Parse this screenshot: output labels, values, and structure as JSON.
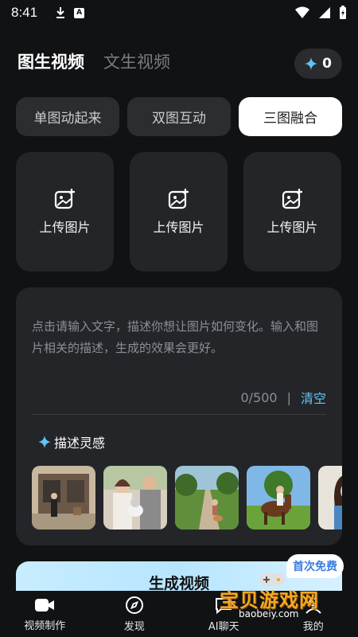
{
  "status_bar": {
    "time": "8:41"
  },
  "tabs": [
    {
      "label": "图生视频",
      "active": true
    },
    {
      "label": "文生视频",
      "active": false
    }
  ],
  "credits": {
    "count": "0",
    "icon": "sparkle-icon"
  },
  "modes": [
    {
      "label": "单图动起来",
      "active": false
    },
    {
      "label": "双图互动",
      "active": false
    },
    {
      "label": "三图融合",
      "active": true
    }
  ],
  "uploads": [
    {
      "label": "上传图片",
      "icon": "image-add-icon"
    },
    {
      "label": "上传图片",
      "icon": "image-add-icon"
    },
    {
      "label": "上传图片",
      "icon": "image-add-icon"
    }
  ],
  "prompt": {
    "placeholder": "点击请输入文字，描述你想让图片如何变化。输入和图片相关的描述，生成的效果会更好。",
    "counter": "0/500",
    "separator": "|",
    "clear_label": "清空"
  },
  "inspiration": {
    "label": "描述灵感"
  },
  "generate": {
    "label": "生成视频",
    "badge": "首次免费"
  },
  "navbar": [
    {
      "label": "视频制作",
      "icon": "video-camera-icon"
    },
    {
      "label": "发现",
      "icon": "compass-icon"
    },
    {
      "label": "AI聊天",
      "icon": "chat-icon"
    },
    {
      "label": "我的",
      "icon": "profile-icon"
    }
  ],
  "watermark": {
    "text": "宝贝游戏网",
    "url": "baobeiy.com"
  },
  "colors": {
    "background": "#111214",
    "card": "#242529",
    "accent": "#5fc5f5",
    "generate": "#c8ecff"
  }
}
